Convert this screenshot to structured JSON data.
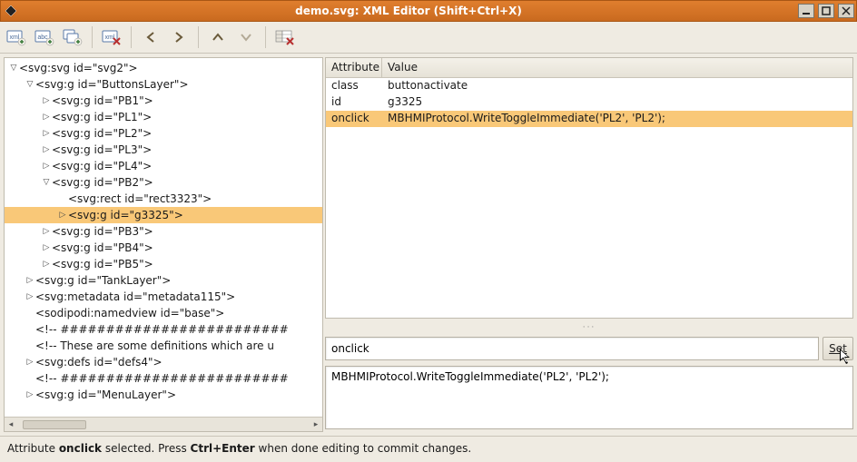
{
  "window": {
    "title": "demo.svg: XML Editor (Shift+Ctrl+X)"
  },
  "toolbar": {
    "new_element": "new-element-node",
    "new_text": "new-text-node",
    "duplicate": "duplicate-node",
    "delete_node": "delete-node",
    "prev": "previous",
    "next": "next",
    "up": "move-up",
    "down": "move-down",
    "delete_attr": "delete-attribute"
  },
  "tree": [
    {
      "depth": 0,
      "expand": "open",
      "label": "<svg:svg id=\"svg2\">",
      "selected": false
    },
    {
      "depth": 1,
      "expand": "open",
      "label": "<svg:g id=\"ButtonsLayer\">",
      "selected": false
    },
    {
      "depth": 2,
      "expand": "closed",
      "label": "<svg:g id=\"PB1\">",
      "selected": false
    },
    {
      "depth": 2,
      "expand": "closed",
      "label": "<svg:g id=\"PL1\">",
      "selected": false
    },
    {
      "depth": 2,
      "expand": "closed",
      "label": "<svg:g id=\"PL2\">",
      "selected": false
    },
    {
      "depth": 2,
      "expand": "closed",
      "label": "<svg:g id=\"PL3\">",
      "selected": false
    },
    {
      "depth": 2,
      "expand": "closed",
      "label": "<svg:g id=\"PL4\">",
      "selected": false
    },
    {
      "depth": 2,
      "expand": "open",
      "label": "<svg:g id=\"PB2\">",
      "selected": false
    },
    {
      "depth": 3,
      "expand": "none",
      "label": "<svg:rect id=\"rect3323\">",
      "selected": false
    },
    {
      "depth": 3,
      "expand": "closed",
      "label": "<svg:g id=\"g3325\">",
      "selected": true
    },
    {
      "depth": 2,
      "expand": "closed",
      "label": "<svg:g id=\"PB3\">",
      "selected": false
    },
    {
      "depth": 2,
      "expand": "closed",
      "label": "<svg:g id=\"PB4\">",
      "selected": false
    },
    {
      "depth": 2,
      "expand": "closed",
      "label": "<svg:g id=\"PB5\">",
      "selected": false
    },
    {
      "depth": 1,
      "expand": "closed",
      "label": "<svg:g id=\"TankLayer\">",
      "selected": false
    },
    {
      "depth": 1,
      "expand": "closed",
      "label": "<svg:metadata id=\"metadata115\">",
      "selected": false
    },
    {
      "depth": 1,
      "expand": "none",
      "label": "<sodipodi:namedview id=\"base\">",
      "selected": false
    },
    {
      "depth": 1,
      "expand": "none",
      "label": "<!-- #########################",
      "selected": false
    },
    {
      "depth": 1,
      "expand": "none",
      "label": "<!-- These are some definitions which are u",
      "selected": false
    },
    {
      "depth": 1,
      "expand": "closed",
      "label": "<svg:defs id=\"defs4\">",
      "selected": false
    },
    {
      "depth": 1,
      "expand": "none",
      "label": "<!-- #########################",
      "selected": false
    },
    {
      "depth": 1,
      "expand": "closed",
      "label": "<svg:g id=\"MenuLayer\">",
      "selected": false
    }
  ],
  "attr_table": {
    "headers": {
      "attribute": "Attribute",
      "value": "Value"
    },
    "rows": [
      {
        "name": "class",
        "value": "buttonactivate",
        "selected": false
      },
      {
        "name": "id",
        "value": "g3325",
        "selected": false
      },
      {
        "name": "onclick",
        "value": "MBHMIProtocol.WriteToggleImmediate('PL2', 'PL2');",
        "selected": true
      }
    ]
  },
  "editor": {
    "attr_name": "onclick",
    "attr_value": "MBHMIProtocol.WriteToggleImmediate('PL2', 'PL2');",
    "set_label": "Set"
  },
  "status": {
    "prefix": "Attribute ",
    "bold1": "onclick",
    "mid": " selected. Press ",
    "bold2": "Ctrl+Enter",
    "suffix": " when done editing to commit changes."
  }
}
